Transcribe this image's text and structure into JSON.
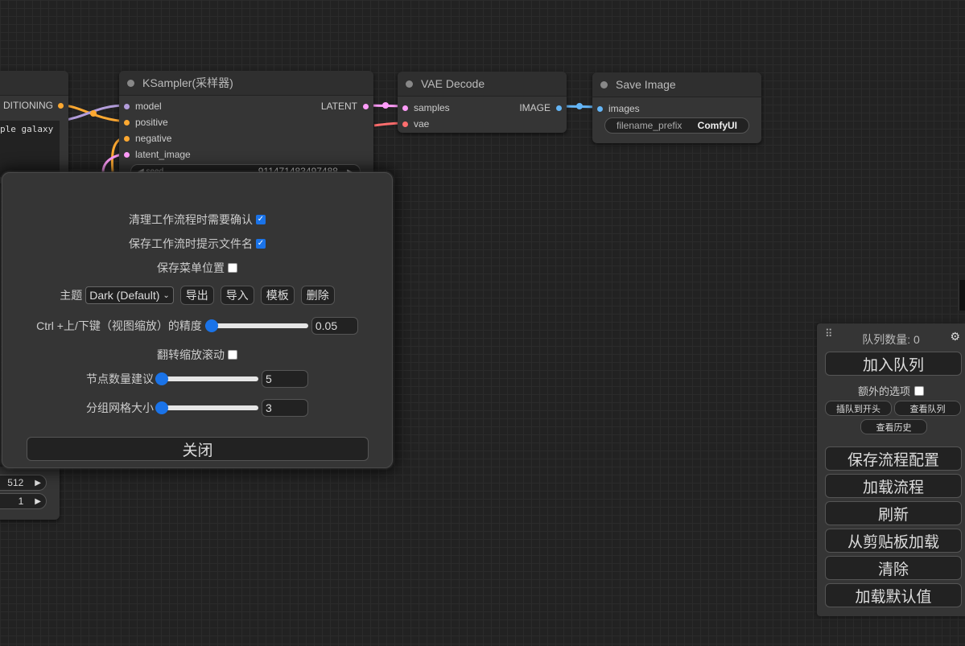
{
  "nodes": {
    "left_partial": {
      "output_label": "DITIONING",
      "text_preview": "ple galaxy",
      "widget1_value": "512",
      "widget2_value": "1"
    },
    "ksampler": {
      "title": "KSampler(采样器)",
      "inputs": [
        "model",
        "positive",
        "negative",
        "latent_image"
      ],
      "output": "LATENT",
      "seed_label": "seed",
      "seed_value": "911471483497488"
    },
    "vae_decode": {
      "title": "VAE Decode",
      "inputs": [
        "samples",
        "vae"
      ],
      "output": "IMAGE"
    },
    "save_image": {
      "title": "Save Image",
      "input": "images",
      "prefix_label": "filename_prefix",
      "prefix_value": "ComfyUI"
    }
  },
  "settings": {
    "confirm_clear_label": "清理工作流程时需要确认",
    "confirm_clear_checked": true,
    "prompt_filename_label": "保存工作流时提示文件名",
    "prompt_filename_checked": true,
    "save_menu_pos_label": "保存菜单位置",
    "save_menu_pos_checked": false,
    "theme_label": "主题",
    "theme_value": "Dark (Default)",
    "theme_export": "导出",
    "theme_import": "导入",
    "theme_template": "模板",
    "theme_delete": "删除",
    "zoom_label": "Ctrl +上/下键（视图缩放）的精度",
    "zoom_value": "0.05",
    "zoom_fraction": 0.0,
    "invert_zoom_label": "翻转缩放滚动",
    "invert_zoom_checked": false,
    "node_suggest_label": "节点数量建议",
    "node_suggest_value": "5",
    "node_suggest_fraction": 0.0,
    "grid_label": "分组网格大小",
    "grid_value": "3",
    "grid_fraction": 0.0,
    "close_label": "关闭"
  },
  "menu": {
    "queue_label": "队列数量: 0",
    "queue_prompt": "加入队列",
    "extra_options": "额外的选项",
    "extra_checked": false,
    "queue_front": "插队到开头",
    "view_queue": "查看队列",
    "view_history": "查看历史",
    "save": "保存流程配置",
    "load": "加载流程",
    "refresh": "刷新",
    "clipspace": "从剪贴板加载",
    "clear": "清除",
    "load_default": "加载默认值"
  },
  "colors": {
    "model": "#b39ddb",
    "conditioning": "#ffa931",
    "latent": "#ff9cf9",
    "vae": "#ff6e6e",
    "image": "#64b5f6",
    "accent": "#1a73e8"
  }
}
